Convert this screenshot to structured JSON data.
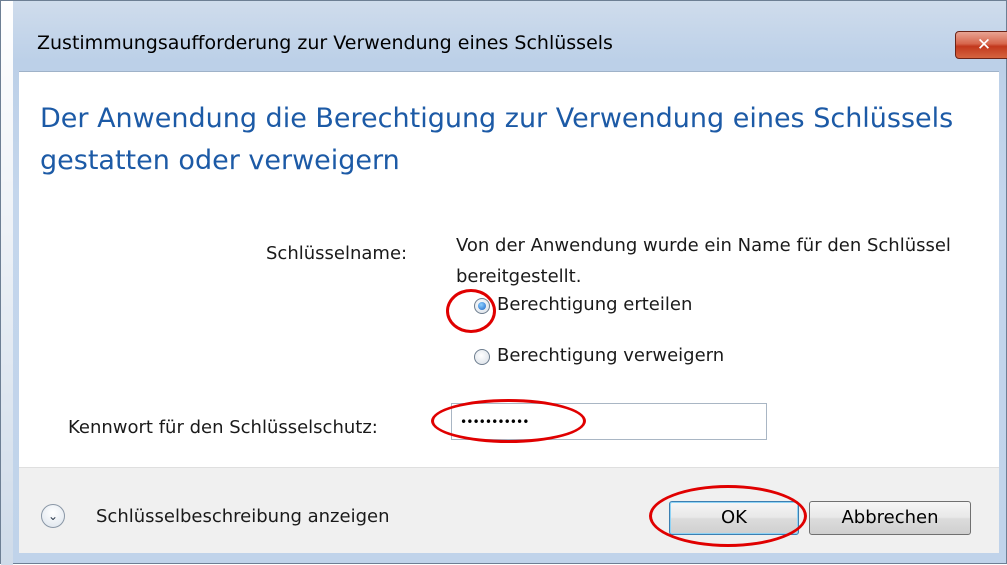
{
  "window": {
    "title": "Zustimmungsaufforderung zur Verwendung eines Schlüssels",
    "close_glyph": "✕"
  },
  "main": {
    "heading": "Der Anwendung die Berechtigung zur Verwendung eines Schlüssels gestatten oder verweigern",
    "key_name_label": "Schlüsselname:",
    "key_name_value": "Von der Anwendung wurde ein Name für den Schlüssel bereitgestellt.",
    "radio_options": [
      {
        "label": "Berechtigung erteilen",
        "checked": true
      },
      {
        "label": "Berechtigung verweigern",
        "checked": false
      }
    ],
    "password_label": "Kennwort für den Schlüsselschutz:",
    "password_value": "•••••••••••"
  },
  "footer": {
    "expand_icon": "chevron-down-icon",
    "expand_glyph": "⌄",
    "expand_label": "Schlüsselbeschreibung anzeigen",
    "ok_label": "OK",
    "cancel_label": "Abbrechen"
  },
  "colors": {
    "heading": "#1c5aa6",
    "highlight": "#e00000",
    "close_button": "#c2381d"
  }
}
